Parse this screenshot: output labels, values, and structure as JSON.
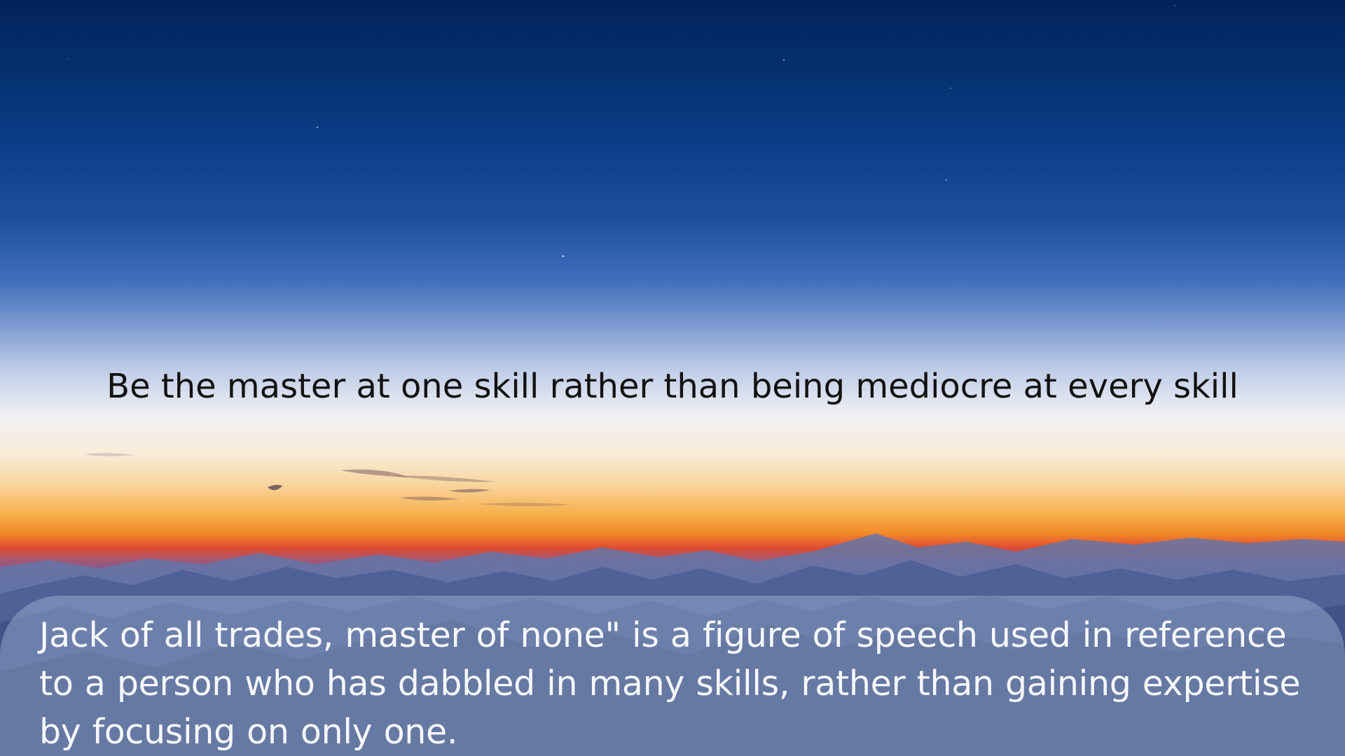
{
  "headline": "Be the master at one skill rather than being mediocre at every skill",
  "info_panel": {
    "text": "Jack of all trades, master of none\" is a figure of speech used in reference to a person who has dabbled in many skills, rather than gaining expertise by focusing on only one."
  },
  "palette": {
    "sky_top": "#03225c",
    "sky_mid": "#1d4f9f",
    "horizon_white": "#f0f0f3",
    "horizon_orange": "#f28a2a",
    "horizon_red": "#df4a31",
    "mountains": "#3f5785",
    "headline_text": "#121212",
    "panel_text": "#f6f8fb"
  },
  "scene": {
    "stars_icon": "star-dot-icon",
    "clouds_icon": "cloud-streak-icon",
    "mountains_icon": "mountain-range-icon"
  }
}
